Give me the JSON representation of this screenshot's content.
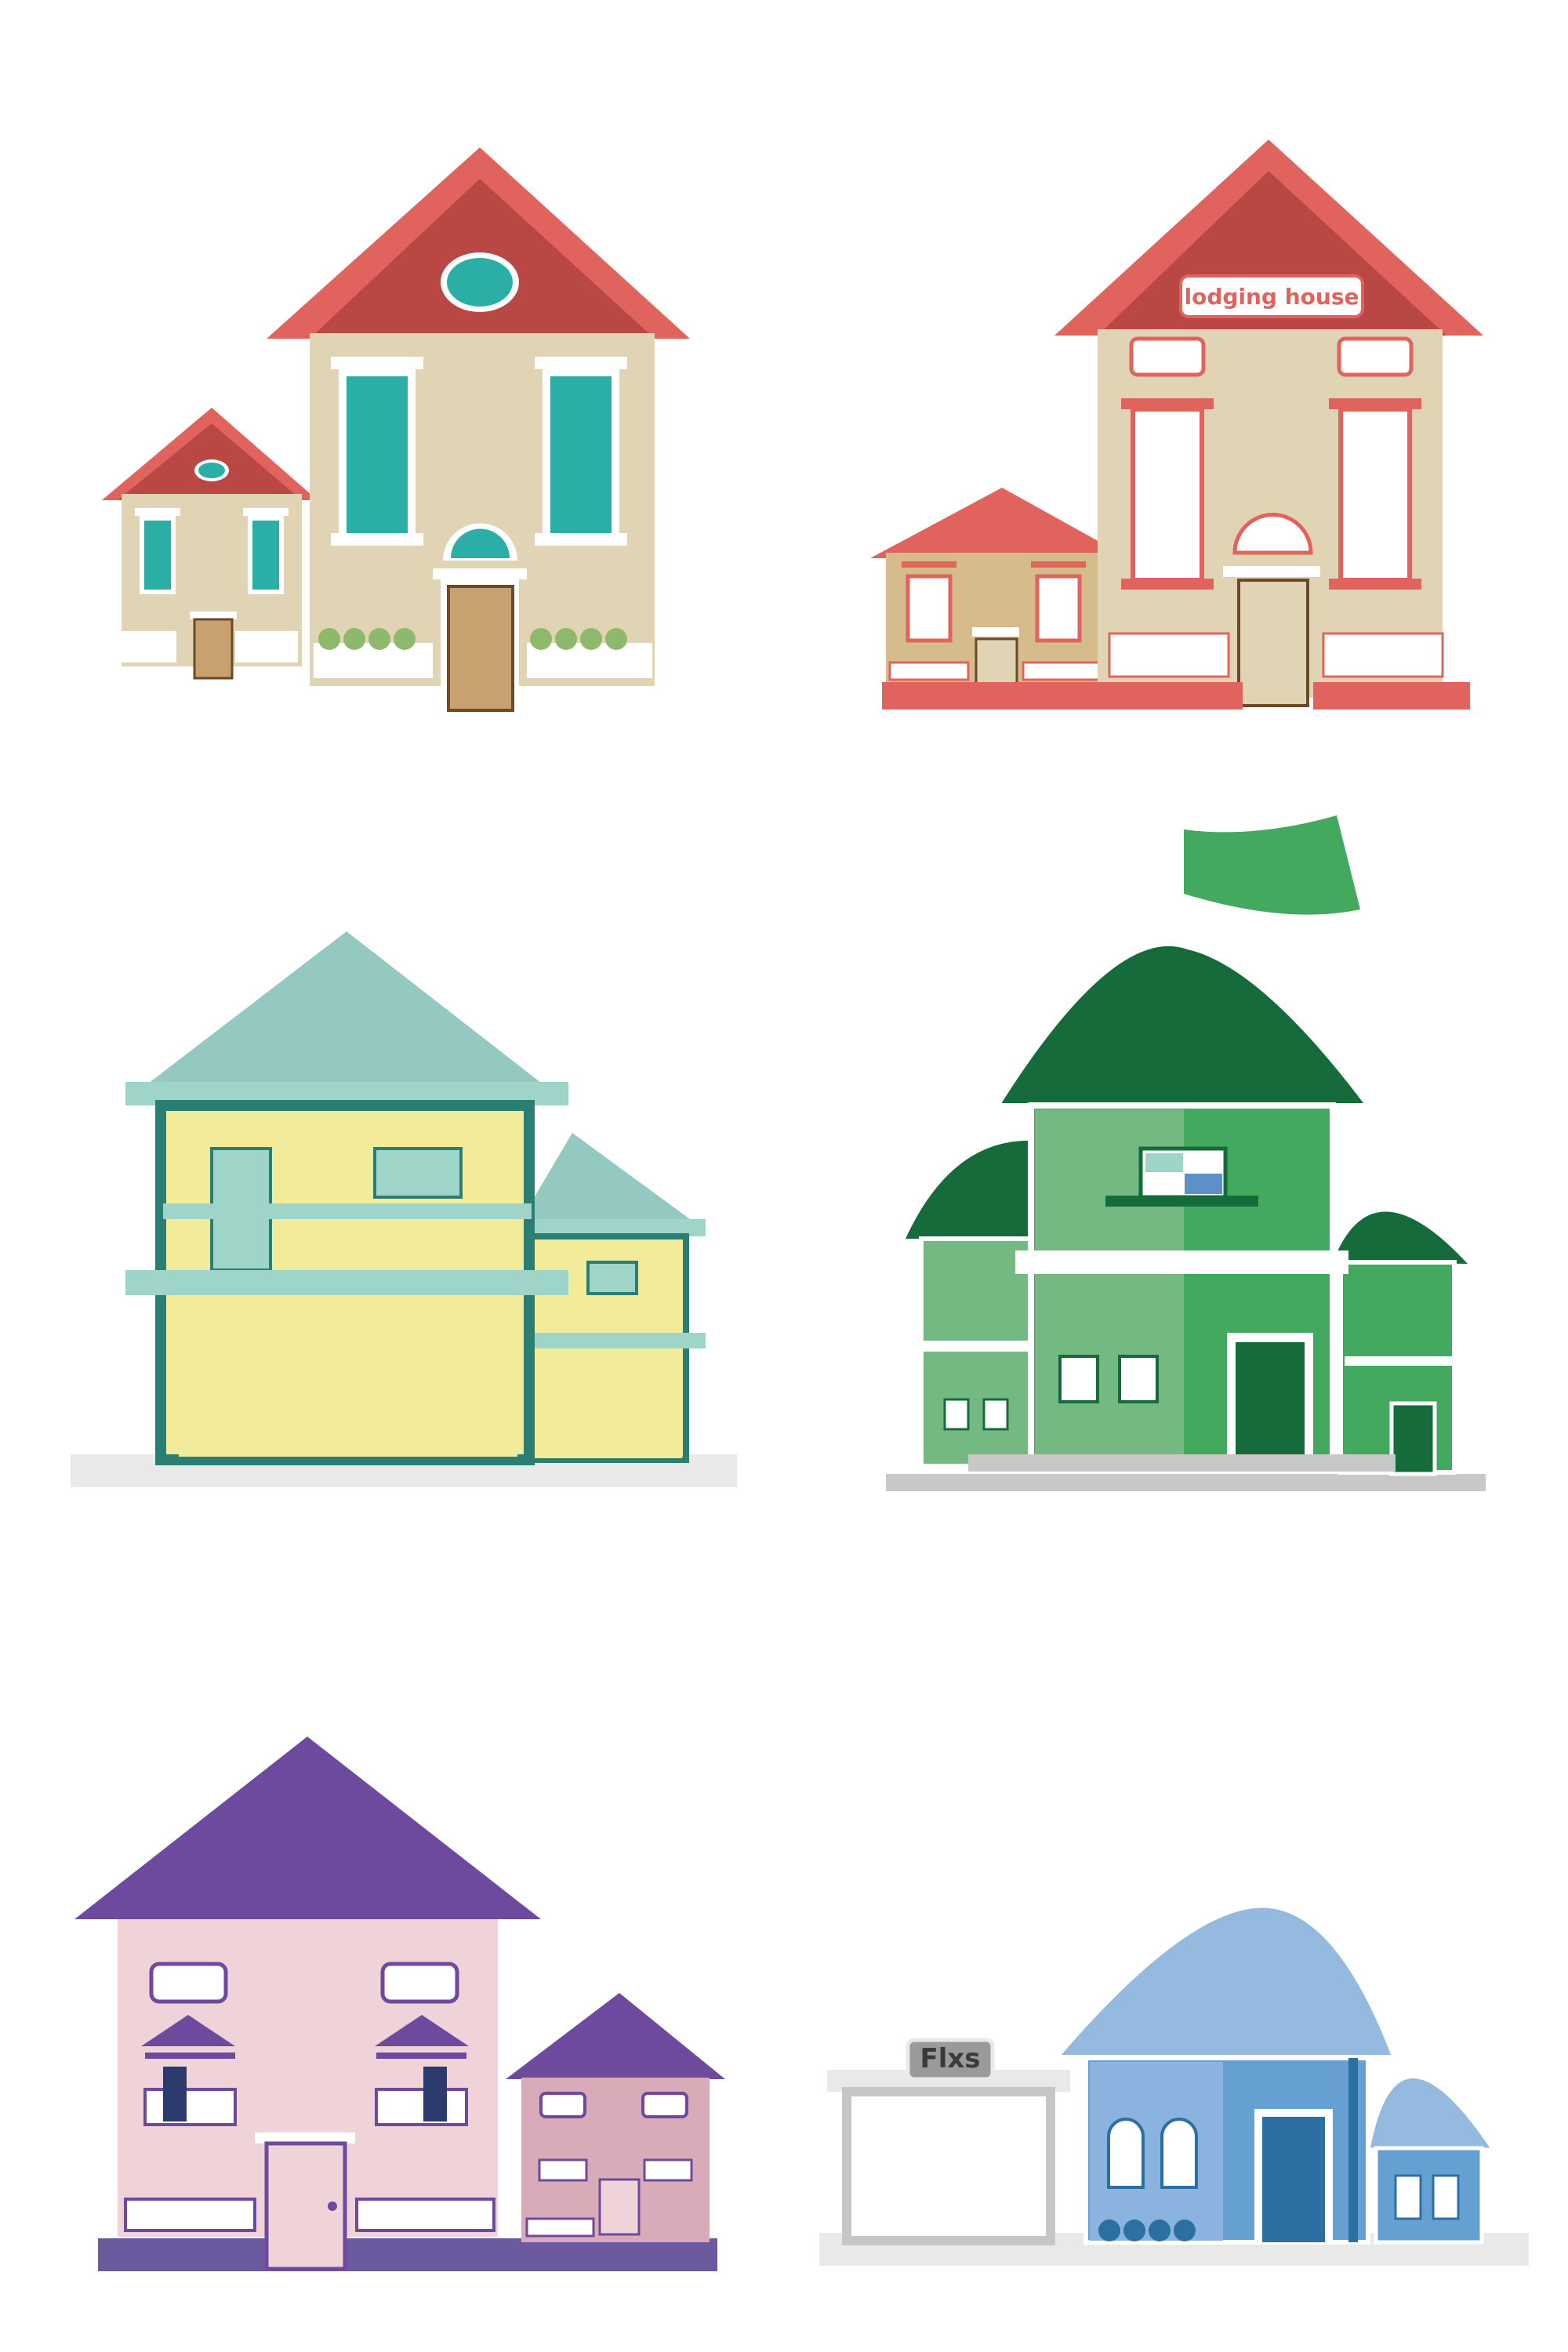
{
  "houses": [
    {
      "name": "beige-house",
      "colors": {
        "roof": "#e0635e",
        "wall": "#e0d4b4",
        "window": "#2aaea6",
        "door": "#c9a070"
      }
    },
    {
      "name": "lodging-house",
      "sign": "lodging house",
      "colors": {
        "roof": "#e0635e",
        "wall": "#e0d4b4",
        "trim": "#e0635e",
        "door": "#e0d4b4"
      }
    },
    {
      "name": "yellow-house",
      "colors": {
        "roof": "#93c9c1",
        "wall": "#f2ec9a",
        "frame": "#2b7f72",
        "trim": "#9fd4c9"
      }
    },
    {
      "name": "green-house",
      "colors": {
        "roof": "#166b3b",
        "wall": "#42a95e",
        "wall_light": "#73b981",
        "door": "#166b3b",
        "flag": "#42a95e"
      }
    },
    {
      "name": "pink-house",
      "colors": {
        "roof": "#6e4a9e",
        "wall": "#efd3d8",
        "trim": "#6e4a9e",
        "base": "#6c5a9e"
      }
    },
    {
      "name": "blue-house",
      "sign": "Flxs",
      "colors": {
        "roof": "#94bbdf",
        "wall": "#66a0d2",
        "door": "#2c6fa3",
        "garage": "#e9e9e9"
      }
    }
  ]
}
